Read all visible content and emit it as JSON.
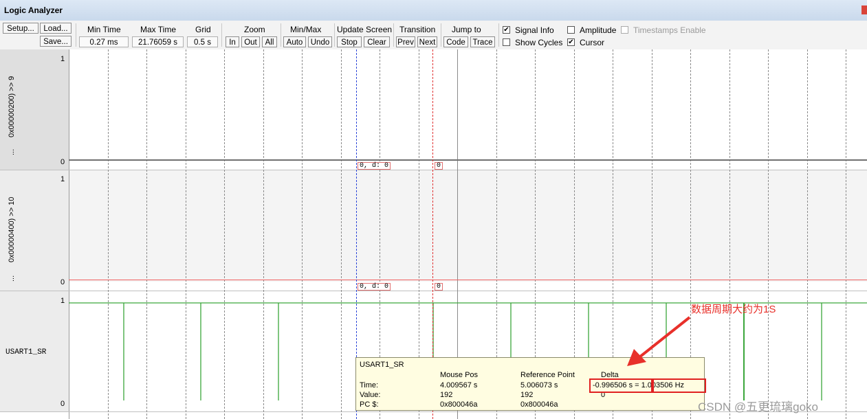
{
  "window": {
    "title": "Logic Analyzer"
  },
  "toolbar": {
    "setup": "Setup...",
    "load": "Load...",
    "save": "Save...",
    "min_time_label": "Min Time",
    "min_time_value": "0.27 ms",
    "max_time_label": "Max Time",
    "max_time_value": "21.76059 s",
    "grid_label": "Grid",
    "grid_value": "0.5 s",
    "zoom_label": "Zoom",
    "zoom_in": "In",
    "zoom_out": "Out",
    "zoom_all": "All",
    "minmax_label": "Min/Max",
    "minmax_auto": "Auto",
    "minmax_undo": "Undo",
    "update_label": "Update Screen",
    "update_stop": "Stop",
    "update_clear": "Clear",
    "transition_label": "Transition",
    "transition_prev": "Prev",
    "transition_next": "Next",
    "jump_label": "Jump to",
    "jump_code": "Code",
    "jump_trace": "Trace",
    "options": {
      "signal_info": {
        "label": "Signal Info",
        "checked": true
      },
      "amplitude": {
        "label": "Amplitude",
        "checked": false
      },
      "timestamps": {
        "label": "Timestamps Enable",
        "checked": false
      },
      "show_cycles": {
        "label": "Show Cycles",
        "checked": false
      },
      "cursor": {
        "label": "Cursor",
        "checked": true
      }
    }
  },
  "signals": [
    {
      "name": "0x00000200) >> 9",
      "prefix": "...",
      "scale_max": "1",
      "scale_min": "0",
      "tag_a": "0,   d:  0",
      "tag_b": "0"
    },
    {
      "name": "0x00000400) >> 10",
      "prefix": "...",
      "scale_max": "1",
      "scale_min": "0",
      "tag_a": "0,   d:  0",
      "tag_b": "0"
    },
    {
      "name": "USART1_SR",
      "scale_max": "1",
      "scale_min": "0"
    }
  ],
  "tooltip": {
    "title": "USART1_SR",
    "col_mouse": "Mouse Pos",
    "col_ref": "Reference Point",
    "col_delta": "Delta",
    "row_time": "Time:",
    "row_value": "Value:",
    "row_pc": "PC $:",
    "mouse_time": "4.009567 s",
    "ref_time": "5.006073 s",
    "delta_time": "-0.996506 s = 1.003506 Hz",
    "mouse_value": "192",
    "ref_value": "192",
    "delta_value": "0",
    "mouse_pc": "0x800046a",
    "ref_pc": "0x800046a"
  },
  "annotation": "数据周期大约为1S",
  "watermark": "CSDN @五更琉璃goko",
  "colors": {
    "cursor_blue": "#2a44d8",
    "cursor_red": "#e03030",
    "signal2": "#f06060",
    "usart": "#3aa63a"
  }
}
